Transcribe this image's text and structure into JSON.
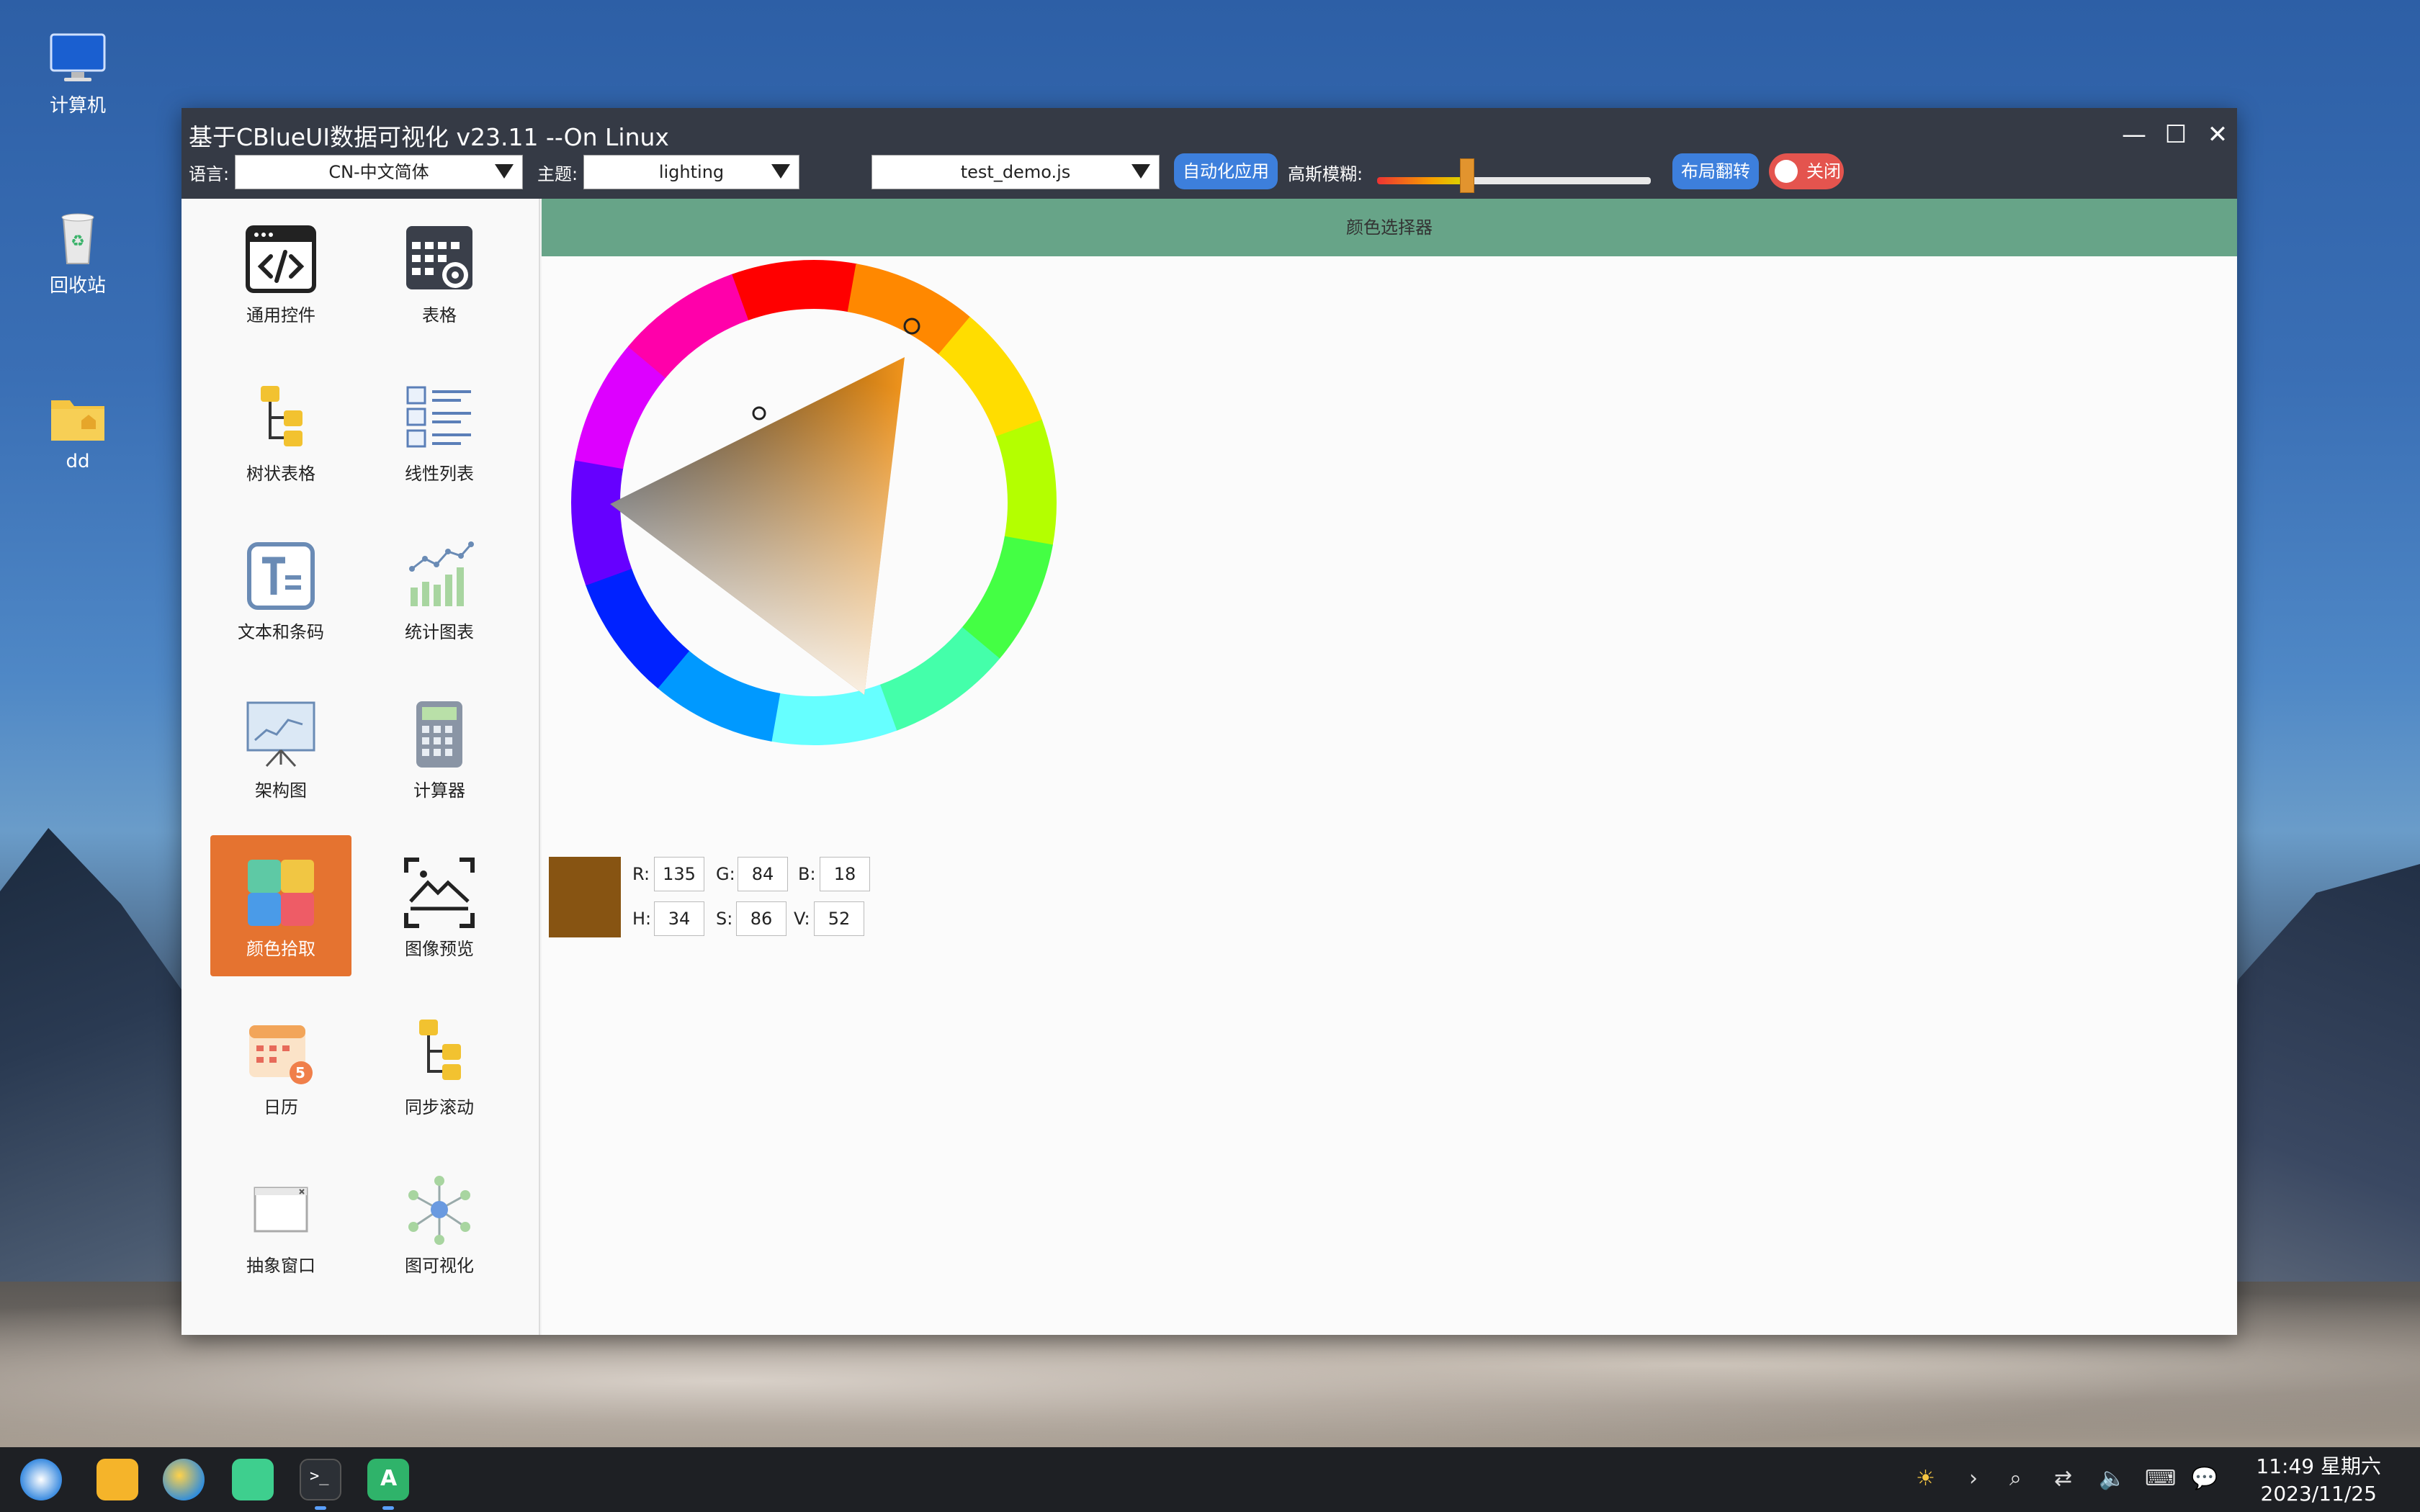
{
  "desktop": {
    "icons": [
      {
        "label": "计算机",
        "icon": "computer-icon"
      },
      {
        "label": "回收站",
        "icon": "trash-icon"
      },
      {
        "label": "dd",
        "icon": "folder-icon"
      }
    ]
  },
  "window": {
    "title": "基于CBlueUI数据可视化 v23.11 --On Linux",
    "controls": {
      "minimize": "—",
      "maximize": "☐",
      "close": "✕"
    }
  },
  "toolbar": {
    "language_label": "语言:",
    "language_value": "CN-中文简体",
    "theme_label": "主题:",
    "theme_value": "lighting",
    "script_value": "test_demo.js",
    "auto_apply_label": "自动化应用",
    "blur_label": "高斯模糊:",
    "blur_level_fraction": 0.33,
    "layout_flip_label": "布局翻转",
    "toggle_label": "关闭"
  },
  "sidebar": {
    "items": [
      {
        "label": "通用控件",
        "icon": "code-window-icon"
      },
      {
        "label": "表格",
        "icon": "table-gear-icon"
      },
      {
        "label": "树状表格",
        "icon": "tree-table-icon"
      },
      {
        "label": "线性列表",
        "icon": "linear-list-icon"
      },
      {
        "label": "文本和条码",
        "icon": "text-icon"
      },
      {
        "label": "统计图表",
        "icon": "chart-icon"
      },
      {
        "label": "架构图",
        "icon": "presentation-board-icon"
      },
      {
        "label": "计算器",
        "icon": "calculator-icon"
      },
      {
        "label": "颜色拾取",
        "icon": "color-palette-icon",
        "active": true
      },
      {
        "label": "图像预览",
        "icon": "image-preview-icon"
      },
      {
        "label": "日历",
        "icon": "calendar-icon",
        "badge": "5"
      },
      {
        "label": "同步滚动",
        "icon": "sync-scroll-icon"
      },
      {
        "label": "抽象窗口",
        "icon": "abstract-window-icon"
      },
      {
        "label": "图可视化",
        "icon": "graph-network-icon"
      }
    ]
  },
  "content": {
    "header": "颜色选择器",
    "color": {
      "swatch_hex": "#875412",
      "R": "135",
      "G": "84",
      "B": "18",
      "H": "34",
      "S": "86",
      "V": "52",
      "labels": {
        "R": "R:",
        "G": "G:",
        "B": "B:",
        "H": "H:",
        "S": "S:",
        "V": "V:"
      }
    }
  },
  "taskbar": {
    "apps": [
      "launcher-icon",
      "file-manager-icon",
      "browser-icon",
      "store-icon",
      "terminal-icon",
      "text-editor-icon"
    ],
    "tray": [
      "brightness-icon",
      "chevron-right-icon",
      "search-icon",
      "network-icon",
      "volume-icon",
      "keyboard-icon",
      "notification-icon"
    ],
    "time": "11:49 星期六",
    "date": "2023/11/25"
  },
  "colors": {
    "titlebar": "#353a45",
    "header_green": "#67a488",
    "active_orange": "#e57330",
    "button_blue": "#3d7fdc",
    "toggle_red": "#e4544e"
  }
}
